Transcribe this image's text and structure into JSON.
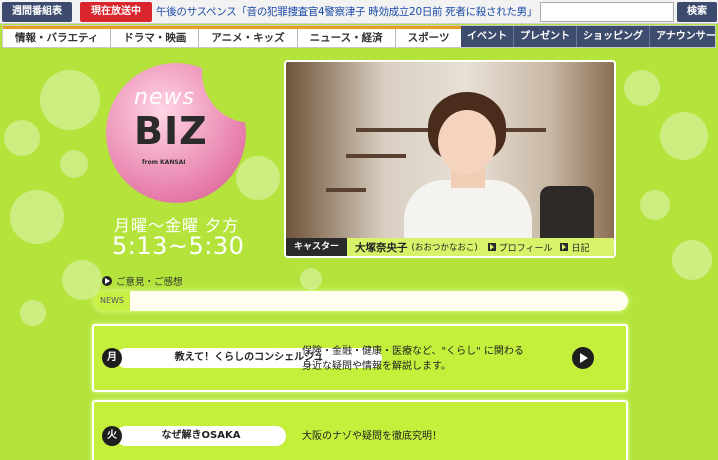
{
  "topbar": {
    "weekly_schedule": "週間番組表",
    "onair_label": "現在放送中",
    "onair_program": "午後のサスペンス「音の犯罪捜査官4警察津子 時効成立20日前 死者に殺された男」",
    "search_placeholder": "",
    "search_button": "検索"
  },
  "nav": {
    "left": [
      "情報・バラエティ",
      "ドラマ・映画",
      "アニメ・キッズ",
      "ニュース・経済",
      "スポーツ"
    ],
    "right": [
      "イベント",
      "プレゼント",
      "ショッピング",
      "アナウンサー"
    ]
  },
  "logo": {
    "news": "news",
    "biz": "BIZ",
    "from": "from KANSAI"
  },
  "schedule": {
    "days": "月曜～金曜 夕方",
    "time": "5:13~5:30"
  },
  "caster": {
    "label": "キャスター",
    "name": "大塚奈央子",
    "reading": "(おおつかなおこ)",
    "profile": "プロフィール",
    "diary": "日記"
  },
  "feedback": "ご意見・ご感想",
  "news_label": "NEWS",
  "corners": [
    {
      "day": "月",
      "title": "教えて！くらしのコンシェルジュ",
      "desc1": "保険・金融・健康・医療など、\"くらし\" に関わる",
      "desc2": "身近な疑問や情報を解説します。"
    },
    {
      "day": "火",
      "title": "なぜ解きOSAKA",
      "desc1": "大阪のナゾや疑問を徹底究明！",
      "desc2": ""
    }
  ],
  "colors": {
    "background": "#b4e43c",
    "nav_dark": "#3e4c6e",
    "onair_red": "#d9262c",
    "accent_pink": "#e67aa8"
  }
}
